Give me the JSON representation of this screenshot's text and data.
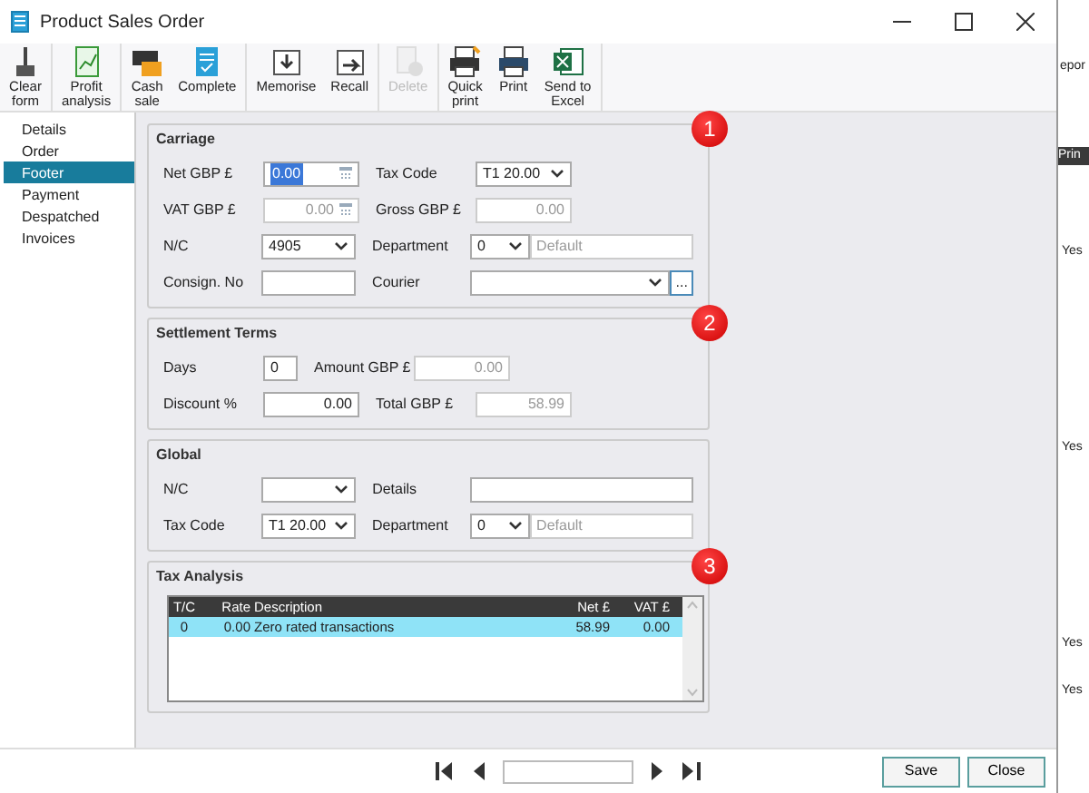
{
  "window": {
    "title": "Product Sales Order"
  },
  "toolbar": {
    "groups": [
      [
        {
          "label": "Clear\nform",
          "disabled": false
        }
      ],
      [
        {
          "label": "Profit\nanalysis",
          "disabled": false
        }
      ],
      [
        {
          "label": "Cash\nsale",
          "disabled": false
        },
        {
          "label": "Complete",
          "disabled": false
        }
      ],
      [
        {
          "label": "Memorise",
          "disabled": false
        },
        {
          "label": "Recall",
          "disabled": false
        }
      ],
      [
        {
          "label": "Delete",
          "disabled": true
        }
      ],
      [
        {
          "label": "Quick\nprint",
          "disabled": false
        },
        {
          "label": "Print",
          "disabled": false
        },
        {
          "label": "Send to\nExcel",
          "disabled": false
        }
      ]
    ]
  },
  "sidebar": {
    "items": [
      {
        "label": "Details",
        "selected": false
      },
      {
        "label": "Order",
        "selected": false
      },
      {
        "label": "Footer",
        "selected": true
      },
      {
        "label": "Payment",
        "selected": false
      },
      {
        "label": "Despatched",
        "selected": false
      },
      {
        "label": "Invoices",
        "selected": false
      }
    ]
  },
  "sections": [
    {
      "title": "Carriage",
      "badge": "1",
      "rows": [
        [
          {
            "label": "Net GBP £",
            "controls": [
              {
                "kind": "calc",
                "value": "0.00",
                "disabled": false,
                "highlighted": true
              }
            ]
          },
          {
            "label": "Tax Code",
            "controls": [
              {
                "kind": "select",
                "value": "T1  20.00",
                "disabled": false
              }
            ]
          }
        ],
        [
          {
            "label": "VAT GBP £",
            "controls": [
              {
                "kind": "calc",
                "value": "0.00",
                "disabled": true,
                "highlighted": false
              }
            ]
          },
          {
            "label": "Gross GBP £",
            "controls": [
              {
                "kind": "number",
                "value": "0.00",
                "disabled": true
              }
            ]
          }
        ],
        [
          {
            "label": "N/C",
            "controls": [
              {
                "kind": "select",
                "value": "4905",
                "disabled": false
              }
            ]
          },
          {
            "label": "Department",
            "controls": [
              {
                "kind": "select",
                "value": "0",
                "disabled": false
              },
              {
                "kind": "text",
                "value": "Default",
                "disabled": true
              }
            ]
          }
        ],
        [
          {
            "label": "Consign. No",
            "controls": [
              {
                "kind": "text",
                "disabled": false
              }
            ]
          },
          {
            "label": "Courier",
            "controls": [
              {
                "kind": "select",
                "disabled": false
              },
              {
                "kind": "button",
                "value": "...",
                "disabled": false
              }
            ]
          }
        ]
      ]
    },
    {
      "title": "Settlement Terms",
      "badge": "2",
      "rows": [
        [
          {
            "label": "Days",
            "controls": [
              {
                "kind": "short",
                "value": "0",
                "disabled": false
              }
            ]
          },
          {
            "label": "Amount GBP £",
            "controls": [
              {
                "kind": "number",
                "value": "0.00",
                "disabled": true
              }
            ]
          }
        ],
        [
          {
            "label": "Discount %",
            "controls": [
              {
                "kind": "number",
                "value": "0.00",
                "disabled": false
              }
            ]
          },
          {
            "label": "Total GBP £",
            "controls": [
              {
                "kind": "number",
                "value": "58.99",
                "disabled": true
              }
            ]
          }
        ]
      ]
    },
    {
      "title": "Global",
      "rows": [
        [
          {
            "label": "N/C",
            "controls": [
              {
                "kind": "select",
                "disabled": false
              }
            ]
          },
          {
            "label": "Details",
            "controls": [
              {
                "kind": "text",
                "disabled": false
              }
            ]
          }
        ],
        [
          {
            "label": "Tax Code",
            "controls": [
              {
                "kind": "select",
                "value": "T1  20.00",
                "disabled": false
              }
            ]
          },
          {
            "label": "Department",
            "controls": [
              {
                "kind": "select",
                "value": "0",
                "disabled": false
              },
              {
                "kind": "text",
                "value": "Default",
                "disabled": true
              }
            ]
          }
        ]
      ]
    }
  ],
  "tax_analysis": {
    "title": "Tax Analysis",
    "badge": "3",
    "columns": [
      "T/C",
      "Rate",
      "Description",
      "Net £",
      "VAT £"
    ],
    "rows": [
      {
        "cells": [
          "0",
          "0.00",
          "Zero rated transactions",
          "58.99",
          "0.00"
        ],
        "selected": true
      }
    ]
  },
  "footer": {
    "buttons": [
      "Save",
      "Close"
    ]
  },
  "background_window": {
    "heading": "epor",
    "column": "Prin",
    "cells": [
      "Yes",
      "Yes",
      "Yes",
      "Yes"
    ]
  }
}
